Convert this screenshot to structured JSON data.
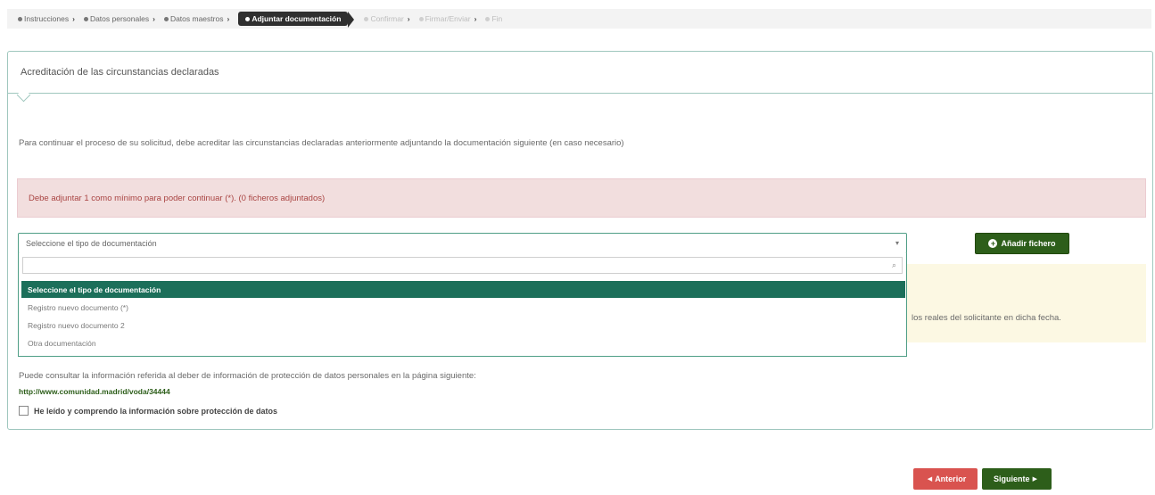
{
  "breadcrumb": {
    "steps": [
      {
        "label": "Instrucciones"
      },
      {
        "label": "Datos personales"
      },
      {
        "label": "Datos maestros"
      },
      {
        "label": "Adjuntar documentación"
      },
      {
        "label": "Confirmar"
      },
      {
        "label": "Firmar/Enviar"
      },
      {
        "label": "Fin"
      }
    ]
  },
  "panel": {
    "title": "Acreditación de las circunstancias declaradas",
    "intro": "Para continuar el proceso de su solicitud, debe acreditar las circunstancias declaradas anteriormente adjuntando la documentación siguiente (en caso necesario)",
    "alert": "Debe adjuntar 1 como mínimo para poder continuar (*). (0 ficheros adjuntados)",
    "info_text": "los reales del solicitante en dicha fecha."
  },
  "select": {
    "value": "Seleccione el tipo de documentación",
    "search_value": "",
    "options": [
      {
        "label": "Seleccione el tipo de documentación",
        "selected": true
      },
      {
        "label": "Registro nuevo documento (*)",
        "selected": false
      },
      {
        "label": "Registro nuevo documento 2",
        "selected": false
      },
      {
        "label": "Otra documentación",
        "selected": false
      }
    ]
  },
  "add_button": {
    "label": "Añadir fichero"
  },
  "privacy": {
    "consult_text": "Puede consultar la información referida al deber de información de protección de datos personales en la página siguiente:",
    "link": "http://www.comunidad.madrid/voda/34444",
    "checkbox_label": "He leído y comprendo la información sobre protección de datos",
    "checked": false
  },
  "footer": {
    "prev_label": "Anterior",
    "next_label": "Siguiente"
  },
  "colors": {
    "accent_green": "#2d5e1a",
    "selected_option": "#1c6f5a",
    "danger": "#d9534f",
    "alert_bg": "#f2dede"
  }
}
